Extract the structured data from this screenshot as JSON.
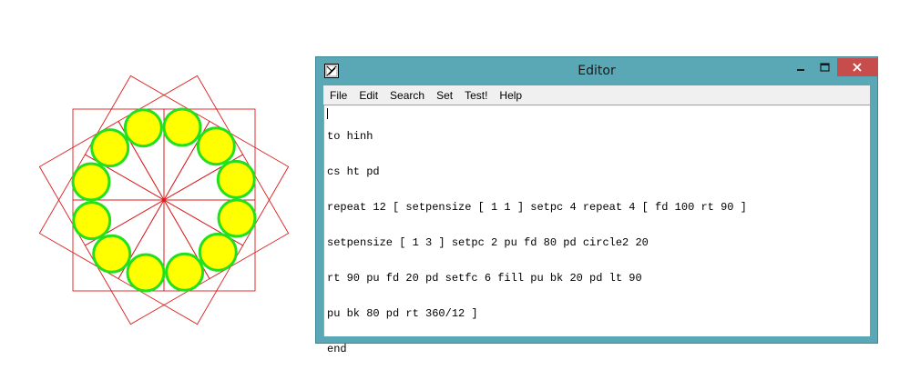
{
  "editor": {
    "title": "Editor",
    "menu": [
      "File",
      "Edit",
      "Search",
      "Set",
      "Test!",
      "Help"
    ],
    "code_lines": [
      "to hinh",
      "cs ht pd",
      "repeat 12 [ setpensize [ 1 1 ] setpc 4 repeat 4 [ fd 100 rt 90 ]",
      "setpensize [ 1 3 ] setpc 2 pu fd 80 pd circle2 20",
      "rt 90 pu fd 20 pd setfc 6 fill pu bk 20 pd lt 90",
      "pu bk 80 pd rt 360/12 ]",
      "end"
    ]
  },
  "icons": {
    "app": "logo-icon",
    "minimize": "minimize-icon",
    "maximize": "maximize-icon",
    "close": "close-icon"
  },
  "colors": {
    "square_stroke": "#dd1c1c",
    "circle_stroke": "#22e01c",
    "circle_fill": "#ffff00",
    "window_frame": "#5aa8b6",
    "close_button": "#c74d4d"
  },
  "drawing": {
    "repeat_count": 12,
    "square_side": 100,
    "circle_distance": 80,
    "circle_radius": 20
  }
}
